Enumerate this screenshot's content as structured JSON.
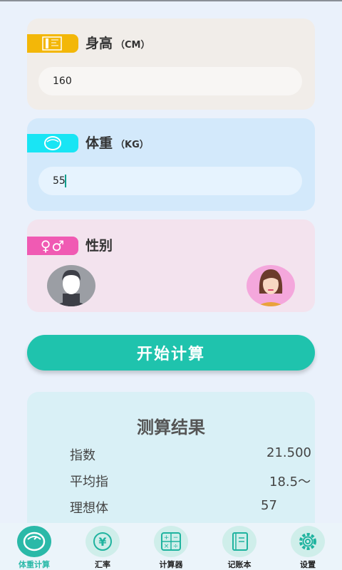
{
  "height": {
    "title": "身高",
    "unit": "（CM）",
    "value": "160"
  },
  "weight": {
    "title": "体重",
    "unit": "（KG）",
    "value": "55"
  },
  "gender": {
    "title": "性别",
    "symbols": "♀♂"
  },
  "calculate_button": "开始计算",
  "result": {
    "title": "测算结果",
    "rows": [
      {
        "label": "指数",
        "value": "21.500"
      },
      {
        "label": "平均指",
        "value": "18.5～"
      },
      {
        "label": "理想体",
        "value": "57"
      }
    ]
  },
  "nav": [
    {
      "label": "体重计算",
      "icon": "scale-icon",
      "active": true
    },
    {
      "label": "汇率",
      "icon": "yen-exchange-icon",
      "active": false
    },
    {
      "label": "计算器",
      "icon": "calculator-icon",
      "active": false
    },
    {
      "label": "记账本",
      "icon": "notebook-icon",
      "active": false
    },
    {
      "label": "设置",
      "icon": "gear-icon",
      "active": false
    }
  ],
  "colors": {
    "accent": "#1fc3ad",
    "height_tag": "#f3b708",
    "weight_tag": "#19e5f4",
    "gender_tag": "#f05ab3"
  }
}
